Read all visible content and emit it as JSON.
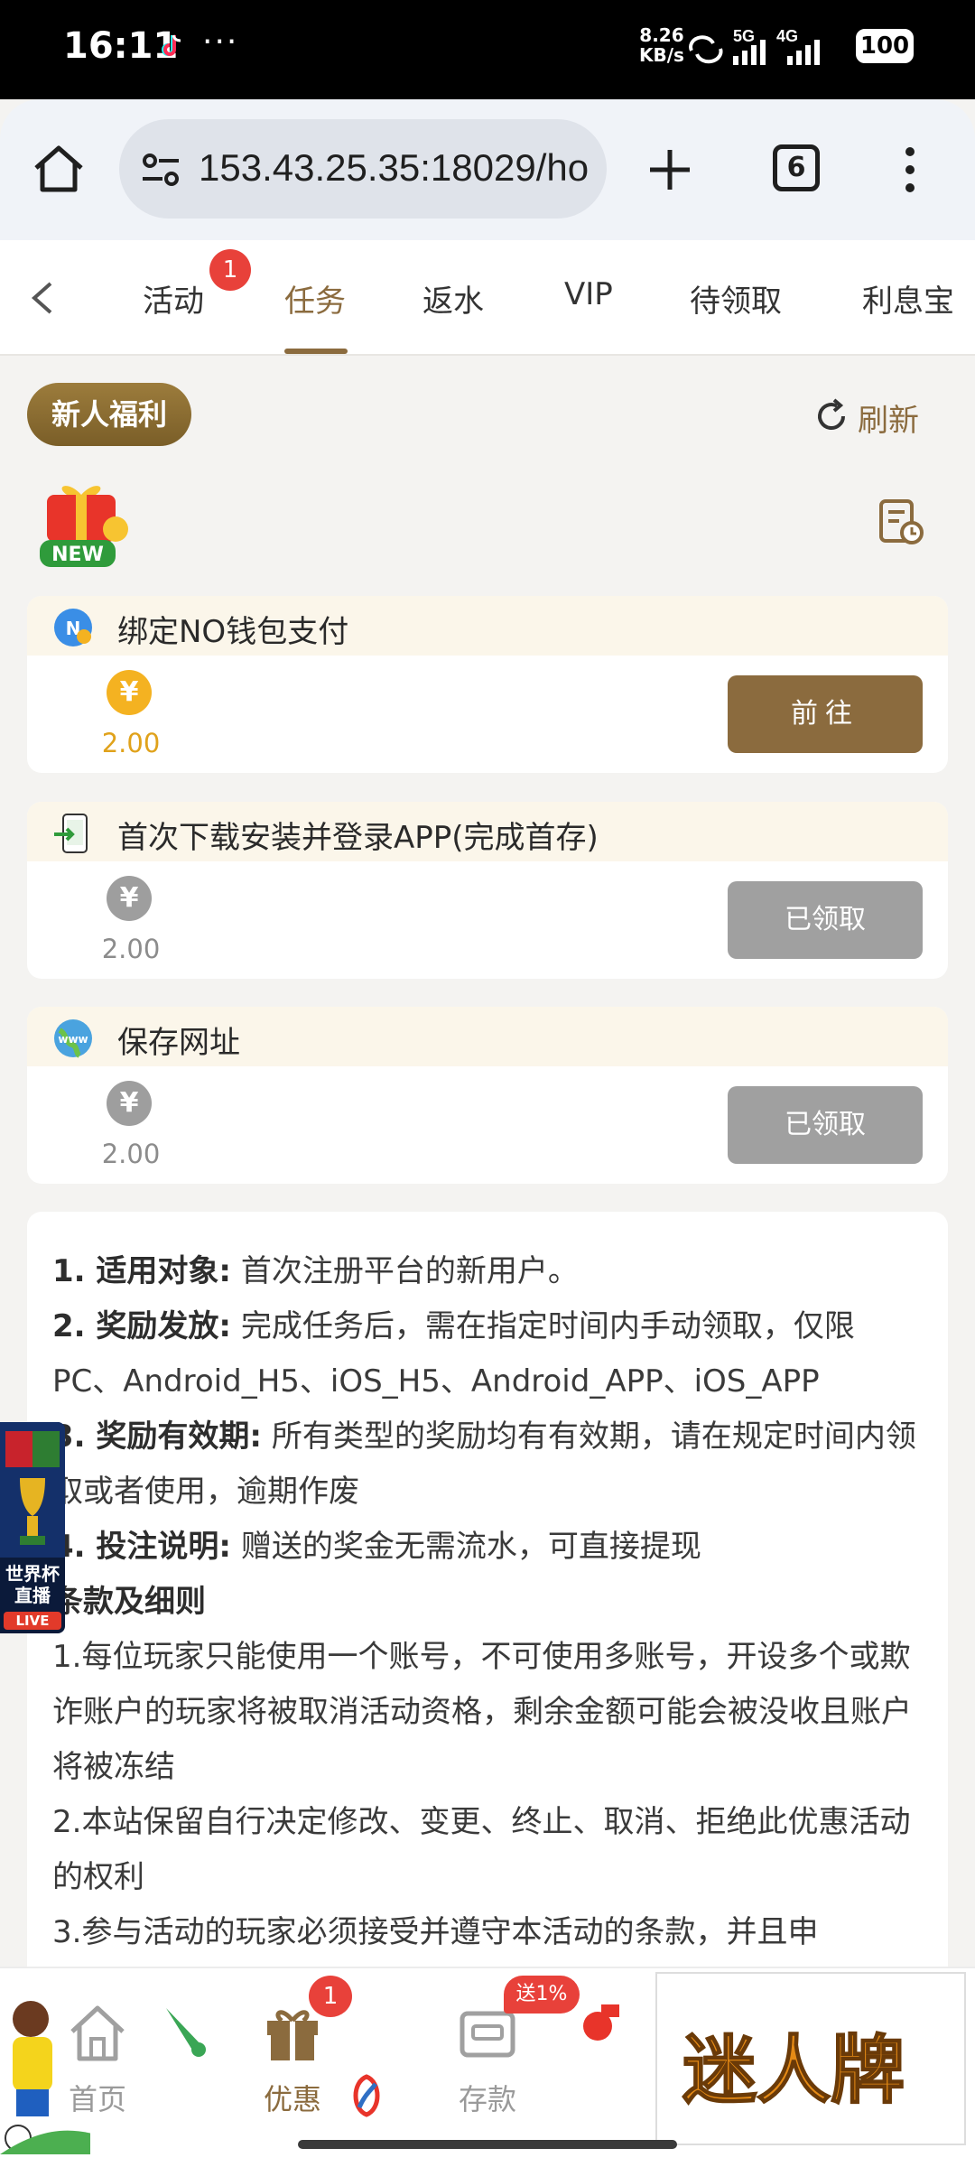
{
  "status_bar": {
    "time": "16:11",
    "dots": "···",
    "speed_value": "8.26",
    "speed_unit": "KB/s",
    "network_1": "5G",
    "network_2": "4G",
    "battery": "100"
  },
  "browser": {
    "url": "153.43.25.35:18029/ho",
    "tab_count": "6"
  },
  "tabs": [
    {
      "label": "活动",
      "badge": "1"
    },
    {
      "label": "任务"
    },
    {
      "label": "返水"
    },
    {
      "label": "VIP"
    },
    {
      "label": "待领取"
    },
    {
      "label": "利息宝"
    }
  ],
  "header": {
    "newcomer_label": "新人福利",
    "refresh_label": "刷新",
    "new_badge": "NEW"
  },
  "tasks": [
    {
      "icon": "no-wallet-icon",
      "title": "绑定NO钱包支付",
      "coin_symbol": "¥",
      "amount": "2.00",
      "button": "前往",
      "status": "available"
    },
    {
      "icon": "phone-download-icon",
      "title": "首次下载安装并登录APP(完成首存)",
      "coin_symbol": "¥",
      "amount": "2.00",
      "button": "已领取",
      "status": "claimed"
    },
    {
      "icon": "www-globe-icon",
      "title": "保存网址",
      "coin_symbol": "¥",
      "amount": "2.00",
      "button": "已领取",
      "status": "claimed"
    }
  ],
  "rules": {
    "items": [
      {
        "num": "1.",
        "title": "适用对象:",
        "text": "首次注册平台的新用户。"
      },
      {
        "num": "2.",
        "title": "奖励发放:",
        "text": "完成任务后，需在指定时间内手动领取，仅限PC、Android_H5、iOS_H5、Android_APP、iOS_APP"
      },
      {
        "num": "3.",
        "title": "奖励有效期:",
        "text": "所有类型的奖励均有有效期，请在规定时间内领取或者使用，逾期作废"
      },
      {
        "num": "4.",
        "title": "投注说明:",
        "text": "赠送的奖金无需流水，可直接提现"
      }
    ],
    "terms_title": "条款及细则",
    "terms": [
      "1.每位玩家只能使用一个账号，不可使用多账号，开设多个或欺诈账户的玩家将被取消活动资格，剩余金额可能会被没收且账户将被冻结",
      "2.本站保留自行决定修改、变更、终止、取消、拒绝此优惠活动的权利",
      "3.参与活动的玩家必须接受并遵守本活动的条款，并且申"
    ]
  },
  "live_banner": {
    "line1": "世界杯",
    "line2": "直播",
    "badge": "LIVE"
  },
  "bottom_nav": {
    "home": "首页",
    "promo": "优惠",
    "promo_badge": "1",
    "deposit": "存款",
    "deposit_badge": "送1%"
  },
  "ad": {
    "text": "迷人牌"
  },
  "colors": {
    "accent": "#8b6b3e",
    "gold": "#f4b221",
    "badge_red": "#e8413a",
    "claimed_gray": "#a0a0a0"
  }
}
